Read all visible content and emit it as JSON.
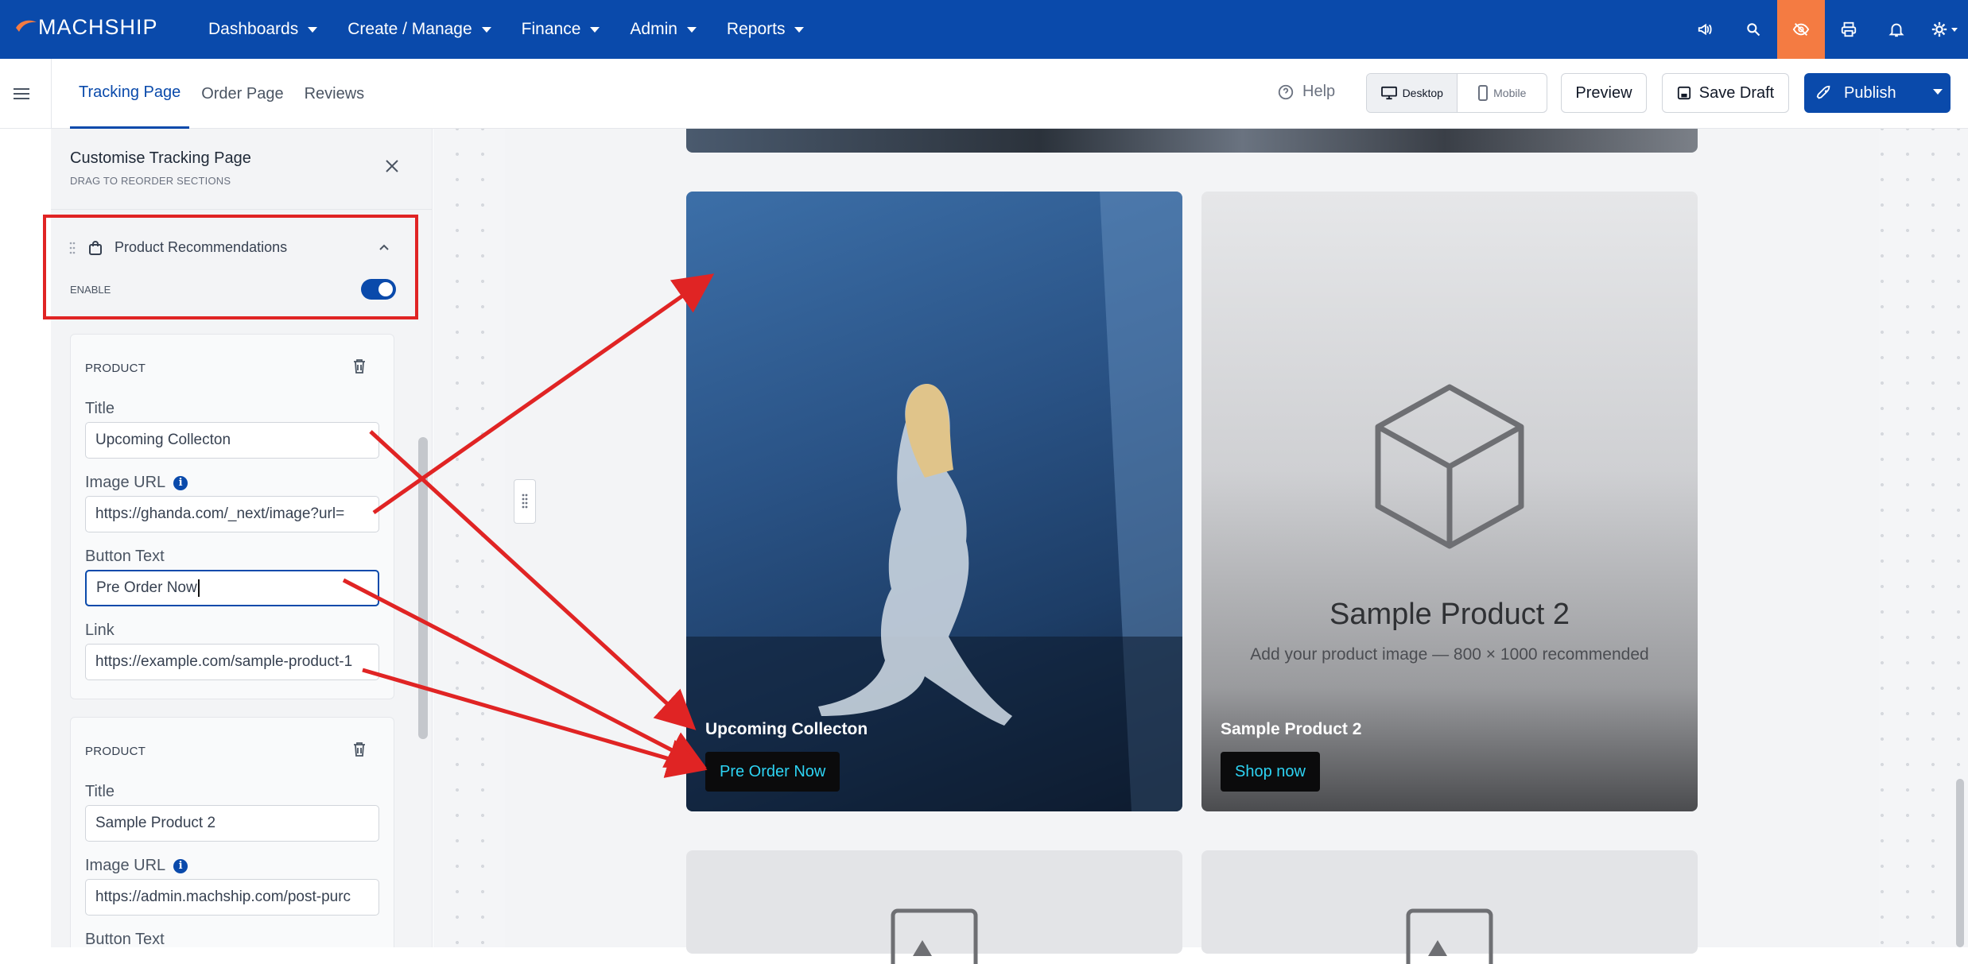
{
  "brand": {
    "logo_text": "MACHSHIP",
    "accent": "#f47b42",
    "primary": "#0a4aab"
  },
  "nav": {
    "items": [
      {
        "label": "Dashboards"
      },
      {
        "label": "Create / Manage"
      },
      {
        "label": "Finance"
      },
      {
        "label": "Admin"
      },
      {
        "label": "Reports"
      }
    ],
    "icons": [
      "megaphone-icon",
      "search-icon",
      "eye-off-icon",
      "printer-icon",
      "bell-icon",
      "gear-icon"
    ]
  },
  "tabs": [
    {
      "label": "Tracking Page",
      "active": true
    },
    {
      "label": "Order Page",
      "active": false
    },
    {
      "label": "Reviews",
      "active": false
    }
  ],
  "toolbar": {
    "help_label": "Help",
    "desktop_label": "Desktop",
    "mobile_label": "Mobile",
    "preview_label": "Preview",
    "save_draft_label": "Save Draft",
    "publish_label": "Publish"
  },
  "panel": {
    "title": "Customise Tracking Page",
    "subtitle": "DRAG TO REORDER SECTIONS",
    "section": {
      "label": "Product Recommendations",
      "enable_label": "ENABLE",
      "enabled": true
    },
    "products": [
      {
        "heading": "PRODUCT",
        "title_label": "Title",
        "title_value": "Upcoming Collecton",
        "image_url_label": "Image URL",
        "image_url_value": "https://ghanda.com/_next/image?url=",
        "button_text_label": "Button Text",
        "button_text_value": "Pre Order Now",
        "link_label": "Link",
        "link_value": "https://example.com/sample-product-1"
      },
      {
        "heading": "PRODUCT",
        "title_label": "Title",
        "title_value": "Sample Product 2",
        "image_url_label": "Image URL",
        "image_url_value": "https://admin.machship.com/post-purc",
        "button_text_label": "Button Text"
      }
    ]
  },
  "preview": {
    "cards": [
      {
        "title": "Upcoming Collecton",
        "button": "Pre Order Now"
      },
      {
        "title": "Sample Product 2",
        "button": "Shop now",
        "placeholder_heading": "Sample Product 2",
        "placeholder_sub": "Add your product image — 800 × 1000 recommended"
      }
    ]
  }
}
